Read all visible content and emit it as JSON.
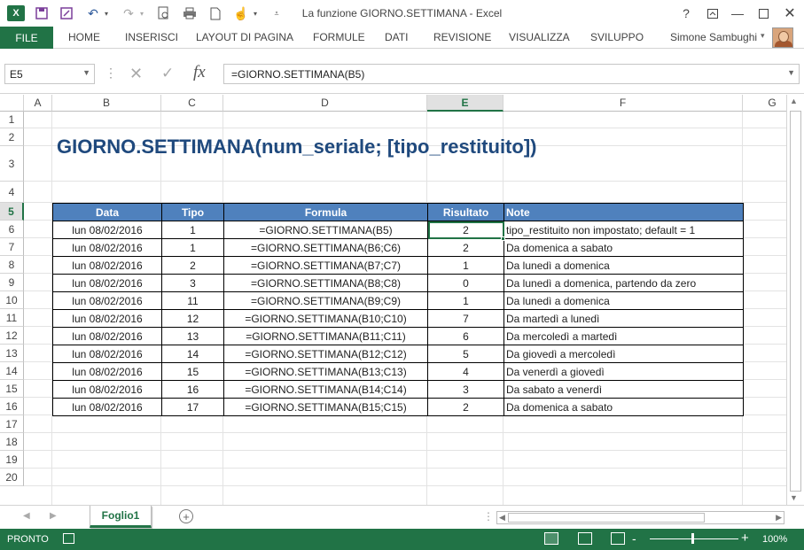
{
  "window": {
    "title": "La funzione GIORNO.SETTIMANA - Excel",
    "app_icon": "excel-logo",
    "help_label": "?",
    "controls": [
      "restore-ribbon-icon",
      "minimize-icon",
      "maximize-icon",
      "close-icon"
    ]
  },
  "quick_access": {
    "icons": [
      "save-icon",
      "save-as-icon",
      "undo-icon",
      "redo-icon",
      "print-preview-icon",
      "print-icon",
      "new-icon",
      "touch-mode-icon",
      "customize-icon"
    ]
  },
  "ribbon": {
    "file_label": "FILE",
    "tabs": [
      "HOME",
      "INSERISCI",
      "LAYOUT DI PAGINA",
      "FORMULE",
      "DATI",
      "REVISIONE",
      "VISUALIZZA",
      "SVILUPPO"
    ],
    "user_name": "Simone Sambughi"
  },
  "formula_bar": {
    "name_box": "E5",
    "formula": "=GIORNO.SETTIMANA(B5)"
  },
  "grid": {
    "columns": [
      "A",
      "B",
      "C",
      "D",
      "E",
      "F",
      "G"
    ],
    "selected_column": "E",
    "rows": [
      "1",
      "2",
      "3",
      "4",
      "5",
      "6",
      "7",
      "8",
      "9",
      "10",
      "11",
      "12",
      "13",
      "14",
      "15",
      "16",
      "17",
      "18",
      "19",
      "20"
    ],
    "selected_row": "5",
    "active_cell": "E5"
  },
  "sheet": {
    "title": "GIORNO.SETTIMANA(num_seriale; [tipo_restituito])",
    "table": {
      "headers": [
        "Data",
        "Tipo",
        "Formula",
        "Risultato",
        "Note"
      ],
      "rows": [
        [
          "lun 08/02/2016",
          "1",
          "=GIORNO.SETTIMANA(B5)",
          "2",
          "tipo_restituito non impostato; default = 1"
        ],
        [
          "lun 08/02/2016",
          "1",
          "=GIORNO.SETTIMANA(B6;C6)",
          "2",
          "Da domenica a sabato"
        ],
        [
          "lun 08/02/2016",
          "2",
          "=GIORNO.SETTIMANA(B7;C7)",
          "1",
          "Da lunedì a domenica"
        ],
        [
          "lun 08/02/2016",
          "3",
          "=GIORNO.SETTIMANA(B8;C8)",
          "0",
          "Da lunedì a domenica, partendo da zero"
        ],
        [
          "lun 08/02/2016",
          "11",
          "=GIORNO.SETTIMANA(B9;C9)",
          "1",
          "Da lunedì a domenica"
        ],
        [
          "lun 08/02/2016",
          "12",
          "=GIORNO.SETTIMANA(B10;C10)",
          "7",
          "Da martedì a lunedì"
        ],
        [
          "lun 08/02/2016",
          "13",
          "=GIORNO.SETTIMANA(B11;C11)",
          "6",
          "Da mercoledì a martedì"
        ],
        [
          "lun 08/02/2016",
          "14",
          "=GIORNO.SETTIMANA(B12;C12)",
          "5",
          "Da giovedì a mercoledì"
        ],
        [
          "lun 08/02/2016",
          "15",
          "=GIORNO.SETTIMANA(B13;C13)",
          "4",
          "Da venerdì a giovedì"
        ],
        [
          "lun 08/02/2016",
          "16",
          "=GIORNO.SETTIMANA(B14;C14)",
          "3",
          "Da sabato a venerdì"
        ],
        [
          "lun 08/02/2016",
          "17",
          "=GIORNO.SETTIMANA(B15;C15)",
          "2",
          "Da domenica a sabato"
        ]
      ]
    }
  },
  "sheet_tabs": {
    "tabs": [
      "Foglio1"
    ],
    "active": "Foglio1",
    "add_label": "+"
  },
  "status_bar": {
    "status": "PRONTO",
    "zoom": "100%",
    "zoom_minus": "-",
    "zoom_plus": "+"
  },
  "colors": {
    "excel_green": "#217346",
    "header_blue": "#4f81bd",
    "title_blue": "#1f497d"
  }
}
